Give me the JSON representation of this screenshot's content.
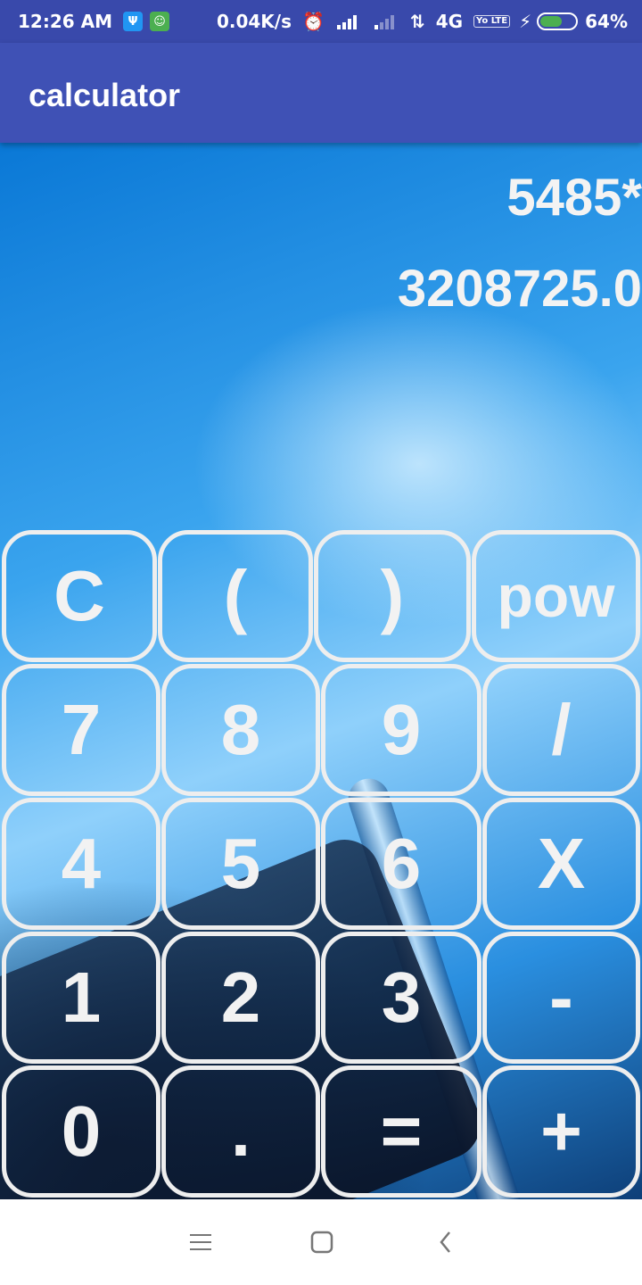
{
  "status_bar": {
    "time": "12:26 AM",
    "net_speed": "0.04K/s",
    "network": "4G",
    "lte": "Yo LTE",
    "battery": "64%",
    "battery_level": 0.64
  },
  "app_bar": {
    "title": "calculator"
  },
  "display": {
    "expression": "5485*",
    "result": "3208725.0"
  },
  "keypad": {
    "row1": [
      "C",
      "(",
      ")",
      "pow"
    ],
    "row2": [
      "7",
      "8",
      "9",
      "/"
    ],
    "row3": [
      "4",
      "5",
      "6",
      "X"
    ],
    "row4": [
      "1",
      "2",
      "3",
      "-"
    ],
    "row5": [
      "0",
      ".",
      "=",
      "+"
    ]
  },
  "colors": {
    "status_bar": "#3949ab",
    "app_bar": "#3f51b5",
    "key_border": "#eeeeee"
  },
  "nav_icons": [
    "menu-icon",
    "home-icon",
    "back-icon"
  ]
}
